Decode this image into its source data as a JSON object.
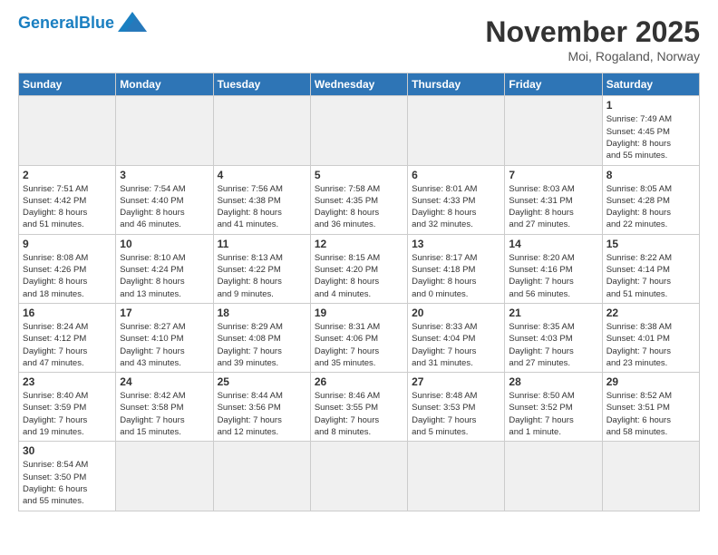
{
  "header": {
    "logo_general": "General",
    "logo_blue": "Blue",
    "month_title": "November 2025",
    "location": "Moi, Rogaland, Norway"
  },
  "weekdays": [
    "Sunday",
    "Monday",
    "Tuesday",
    "Wednesday",
    "Thursday",
    "Friday",
    "Saturday"
  ],
  "weeks": [
    [
      {
        "day": "",
        "info": ""
      },
      {
        "day": "",
        "info": ""
      },
      {
        "day": "",
        "info": ""
      },
      {
        "day": "",
        "info": ""
      },
      {
        "day": "",
        "info": ""
      },
      {
        "day": "",
        "info": ""
      },
      {
        "day": "1",
        "info": "Sunrise: 7:49 AM\nSunset: 4:45 PM\nDaylight: 8 hours\nand 55 minutes."
      }
    ],
    [
      {
        "day": "2",
        "info": "Sunrise: 7:51 AM\nSunset: 4:42 PM\nDaylight: 8 hours\nand 51 minutes."
      },
      {
        "day": "3",
        "info": "Sunrise: 7:54 AM\nSunset: 4:40 PM\nDaylight: 8 hours\nand 46 minutes."
      },
      {
        "day": "4",
        "info": "Sunrise: 7:56 AM\nSunset: 4:38 PM\nDaylight: 8 hours\nand 41 minutes."
      },
      {
        "day": "5",
        "info": "Sunrise: 7:58 AM\nSunset: 4:35 PM\nDaylight: 8 hours\nand 36 minutes."
      },
      {
        "day": "6",
        "info": "Sunrise: 8:01 AM\nSunset: 4:33 PM\nDaylight: 8 hours\nand 32 minutes."
      },
      {
        "day": "7",
        "info": "Sunrise: 8:03 AM\nSunset: 4:31 PM\nDaylight: 8 hours\nand 27 minutes."
      },
      {
        "day": "8",
        "info": "Sunrise: 8:05 AM\nSunset: 4:28 PM\nDaylight: 8 hours\nand 22 minutes."
      }
    ],
    [
      {
        "day": "9",
        "info": "Sunrise: 8:08 AM\nSunset: 4:26 PM\nDaylight: 8 hours\nand 18 minutes."
      },
      {
        "day": "10",
        "info": "Sunrise: 8:10 AM\nSunset: 4:24 PM\nDaylight: 8 hours\nand 13 minutes."
      },
      {
        "day": "11",
        "info": "Sunrise: 8:13 AM\nSunset: 4:22 PM\nDaylight: 8 hours\nand 9 minutes."
      },
      {
        "day": "12",
        "info": "Sunrise: 8:15 AM\nSunset: 4:20 PM\nDaylight: 8 hours\nand 4 minutes."
      },
      {
        "day": "13",
        "info": "Sunrise: 8:17 AM\nSunset: 4:18 PM\nDaylight: 8 hours\nand 0 minutes."
      },
      {
        "day": "14",
        "info": "Sunrise: 8:20 AM\nSunset: 4:16 PM\nDaylight: 7 hours\nand 56 minutes."
      },
      {
        "day": "15",
        "info": "Sunrise: 8:22 AM\nSunset: 4:14 PM\nDaylight: 7 hours\nand 51 minutes."
      }
    ],
    [
      {
        "day": "16",
        "info": "Sunrise: 8:24 AM\nSunset: 4:12 PM\nDaylight: 7 hours\nand 47 minutes."
      },
      {
        "day": "17",
        "info": "Sunrise: 8:27 AM\nSunset: 4:10 PM\nDaylight: 7 hours\nand 43 minutes."
      },
      {
        "day": "18",
        "info": "Sunrise: 8:29 AM\nSunset: 4:08 PM\nDaylight: 7 hours\nand 39 minutes."
      },
      {
        "day": "19",
        "info": "Sunrise: 8:31 AM\nSunset: 4:06 PM\nDaylight: 7 hours\nand 35 minutes."
      },
      {
        "day": "20",
        "info": "Sunrise: 8:33 AM\nSunset: 4:04 PM\nDaylight: 7 hours\nand 31 minutes."
      },
      {
        "day": "21",
        "info": "Sunrise: 8:35 AM\nSunset: 4:03 PM\nDaylight: 7 hours\nand 27 minutes."
      },
      {
        "day": "22",
        "info": "Sunrise: 8:38 AM\nSunset: 4:01 PM\nDaylight: 7 hours\nand 23 minutes."
      }
    ],
    [
      {
        "day": "23",
        "info": "Sunrise: 8:40 AM\nSunset: 3:59 PM\nDaylight: 7 hours\nand 19 minutes."
      },
      {
        "day": "24",
        "info": "Sunrise: 8:42 AM\nSunset: 3:58 PM\nDaylight: 7 hours\nand 15 minutes."
      },
      {
        "day": "25",
        "info": "Sunrise: 8:44 AM\nSunset: 3:56 PM\nDaylight: 7 hours\nand 12 minutes."
      },
      {
        "day": "26",
        "info": "Sunrise: 8:46 AM\nSunset: 3:55 PM\nDaylight: 7 hours\nand 8 minutes."
      },
      {
        "day": "27",
        "info": "Sunrise: 8:48 AM\nSunset: 3:53 PM\nDaylight: 7 hours\nand 5 minutes."
      },
      {
        "day": "28",
        "info": "Sunrise: 8:50 AM\nSunset: 3:52 PM\nDaylight: 7 hours\nand 1 minute."
      },
      {
        "day": "29",
        "info": "Sunrise: 8:52 AM\nSunset: 3:51 PM\nDaylight: 6 hours\nand 58 minutes."
      }
    ],
    [
      {
        "day": "30",
        "info": "Sunrise: 8:54 AM\nSunset: 3:50 PM\nDaylight: 6 hours\nand 55 minutes."
      },
      {
        "day": "",
        "info": ""
      },
      {
        "day": "",
        "info": ""
      },
      {
        "day": "",
        "info": ""
      },
      {
        "day": "",
        "info": ""
      },
      {
        "day": "",
        "info": ""
      },
      {
        "day": "",
        "info": ""
      }
    ]
  ]
}
